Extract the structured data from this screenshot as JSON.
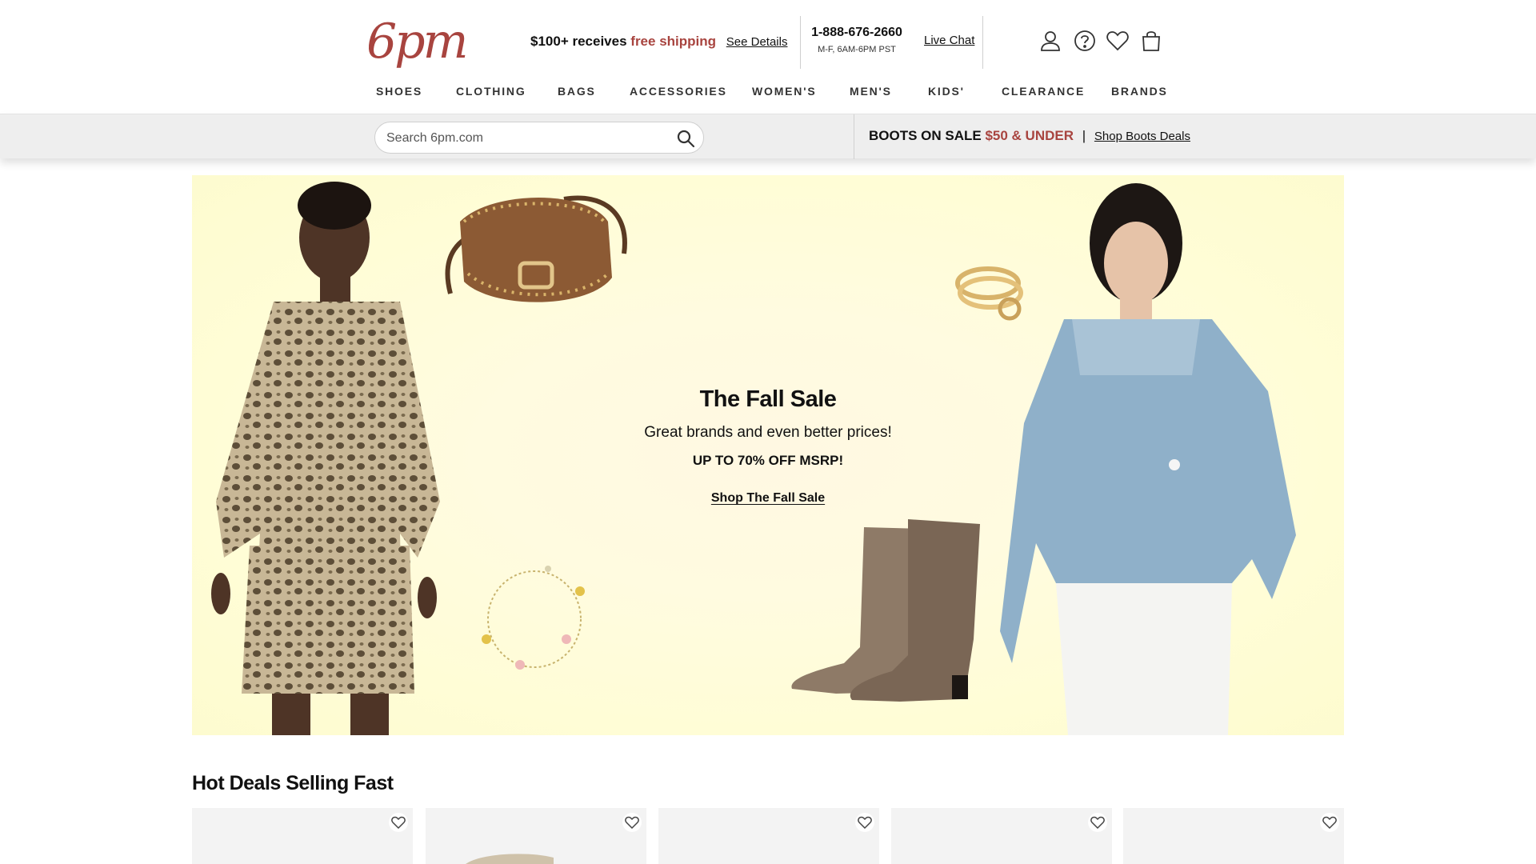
{
  "brand": {
    "logo_text": "6pm",
    "color": "#a8443f"
  },
  "header": {
    "promo_prefix": "$100+ receives",
    "promo_accent": "free shipping",
    "promo_link": "See Details",
    "phone": "1-888-676-2660",
    "hours": "M-F, 6AM-6PM PST",
    "live_chat": "Live Chat",
    "icons": [
      "account-icon",
      "help-icon",
      "favorites-icon",
      "shopping-bag-icon"
    ]
  },
  "nav": {
    "items": [
      "SHOES",
      "CLOTHING",
      "BAGS",
      "ACCESSORIES",
      "WOMEN'S",
      "MEN'S",
      "KIDS'",
      "CLEARANCE",
      "BRANDS"
    ]
  },
  "search": {
    "placeholder": "Search 6pm.com",
    "value": ""
  },
  "promo_bar": {
    "label": "BOOTS ON SALE",
    "accent": "$50 & UNDER",
    "separator": "|",
    "link": "Shop Boots Deals"
  },
  "hero": {
    "title": "The Fall Sale",
    "subtitle": "Great brands and even better prices!",
    "discount": "UP TO 70% OFF MSRP!",
    "cta": "Shop The Fall Sale"
  },
  "deals": {
    "title": "Hot Deals Selling Fast",
    "card_count": 5
  }
}
